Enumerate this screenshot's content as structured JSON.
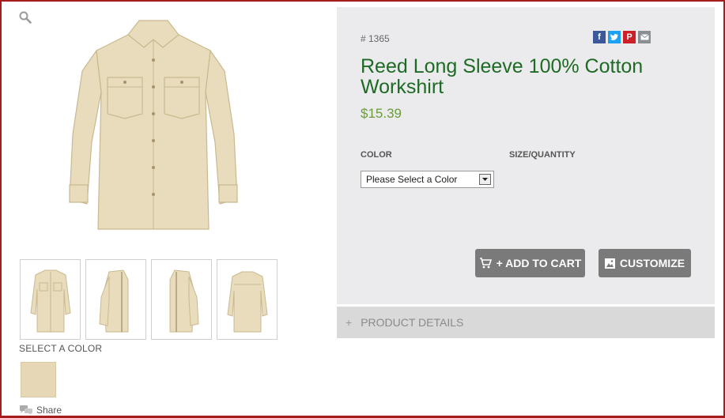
{
  "product": {
    "sku": "# 1365",
    "title": "Reed Long Sleeve 100% Cotton Workshirt",
    "price": "$15.39"
  },
  "options": {
    "color_label": "COLOR",
    "size_label": "SIZE/QUANTITY",
    "color_select_value": "Please Select a Color"
  },
  "buttons": {
    "add_to_cart": "+ ADD TO CART",
    "customize": "CUSTOMIZE"
  },
  "details": {
    "label": "PRODUCT DETAILS",
    "toggle": "+"
  },
  "gallery": {
    "select_color_label": "SELECT A COLOR",
    "share_label": "Share",
    "swatch_color": "#e6d8b6",
    "shirt_color": "#e8dcbd"
  },
  "social": {
    "icons": [
      "facebook-icon",
      "twitter-icon",
      "pinterest-icon",
      "email-icon"
    ],
    "colors": [
      "#3b5998",
      "#1da1f2",
      "#cb2027",
      "#8a8f93"
    ]
  },
  "theme": {
    "title_color": "#1d6b24",
    "price_color": "#6b9c3a",
    "frame_color": "#a51c1c",
    "panel_bg": "#ebeaed",
    "button_bg": "#7a7a7a"
  }
}
